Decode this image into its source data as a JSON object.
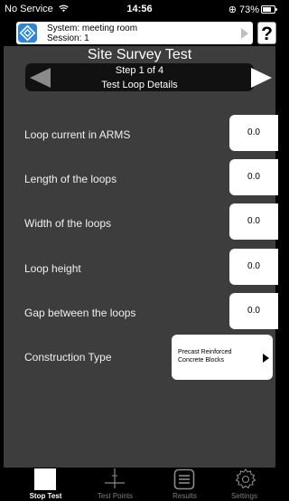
{
  "status": {
    "carrier": "No Service",
    "time": "14:56",
    "battery": "73%",
    "battery_level": 0.73
  },
  "system": {
    "line1": "System: meeting room",
    "line2": "Session: 1",
    "help_label": "?"
  },
  "header": {
    "title": "Site Survey Test",
    "step": "Step 1 of 4",
    "step_name": "Test Loop Details"
  },
  "fields": [
    {
      "label": "Loop current in ARMS",
      "value": "0.0"
    },
    {
      "label": "Length of the loops",
      "value": "0.0"
    },
    {
      "label": "Width of the loops",
      "value": "0.0"
    },
    {
      "label": "Loop height",
      "value": "0.0"
    },
    {
      "label": "Gap between the loops",
      "value": "0.0"
    }
  ],
  "construction": {
    "label": "Construction Type",
    "line1": "Precast Reinforced",
    "line2": "Concrete Blocks"
  },
  "tabs": [
    {
      "label": "Stop Test",
      "icon": "stop-icon",
      "active": true
    },
    {
      "label": "Test Points",
      "icon": "crosshair-icon",
      "active": false
    },
    {
      "label": "Results",
      "icon": "list-icon",
      "active": false
    },
    {
      "label": "Settings",
      "icon": "gear-icon",
      "active": false
    }
  ]
}
